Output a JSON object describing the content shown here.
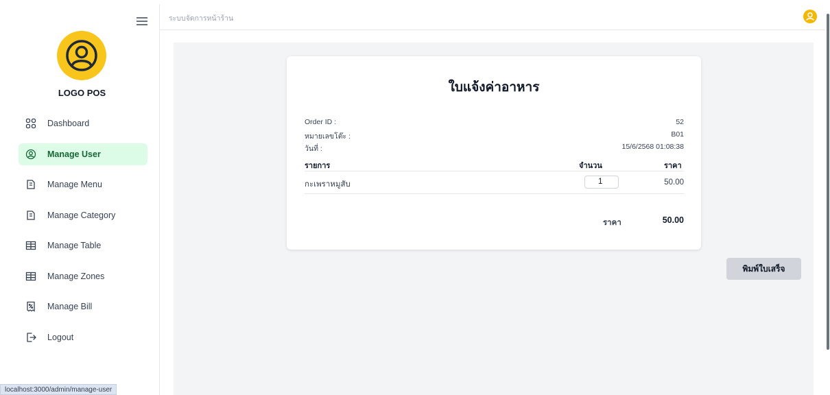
{
  "sidebar": {
    "logo_text": "LOGO POS",
    "items": [
      {
        "label": "Dashboard",
        "icon": "dashboard-icon",
        "active": false
      },
      {
        "label": "Manage User",
        "icon": "user-circle-icon",
        "active": true
      },
      {
        "label": "Manage Menu",
        "icon": "menu-book-icon",
        "active": false
      },
      {
        "label": "Manage Category",
        "icon": "category-icon",
        "active": false
      },
      {
        "label": "Manage Table",
        "icon": "table-icon",
        "active": false
      },
      {
        "label": "Manage Zones",
        "icon": "zones-icon",
        "active": false
      },
      {
        "label": "Manage Bill",
        "icon": "bill-icon",
        "active": false
      },
      {
        "label": "Logout",
        "icon": "logout-icon",
        "active": false
      }
    ]
  },
  "status_url": "localhost:3000/admin/manage-user",
  "header": {
    "title": "ระบบจัดการหน้าร้าน"
  },
  "receipt": {
    "title": "ใบแจ้งค่าอาหาร",
    "order_id_label": "Order ID :",
    "order_id_value": "52",
    "table_label": "หมายเลขโต๊ะ :",
    "table_value": "B01",
    "date_label": "วันที่ :",
    "date_value": "15/6/2568 01:08:38",
    "columns": {
      "item": "รายการ",
      "qty": "จำนวน",
      "price": "ราคา"
    },
    "items": [
      {
        "name": "กะเพราหมูสับ",
        "qty": "1",
        "price": "50.00"
      }
    ],
    "total_label": "ราคา",
    "total_value": "50.00"
  },
  "print_button": "พิมพ์ใบเสร็จ",
  "colors": {
    "accent": "#f7c51c",
    "active_bg": "#dcfce7",
    "active_text": "#166534"
  }
}
